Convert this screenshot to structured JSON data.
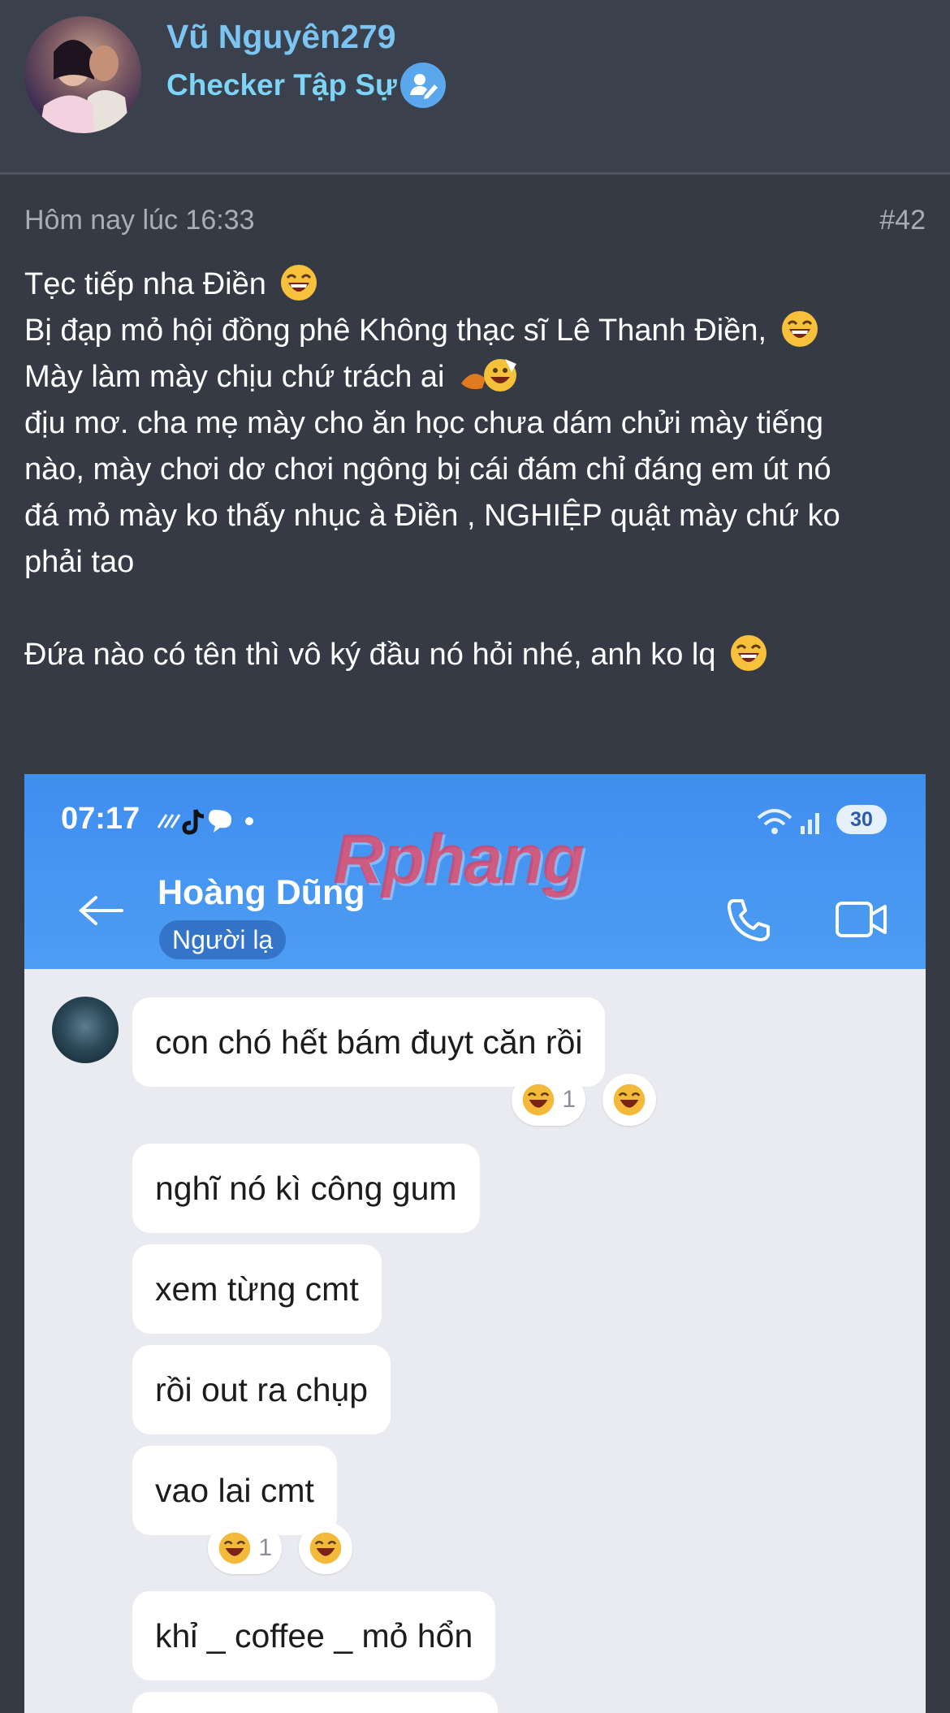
{
  "user": {
    "name": "Vũ Nguyên279",
    "title": "Checker Tập Sự"
  },
  "post": {
    "time": "Hôm nay lúc 16:33",
    "number": "#42",
    "lines": [
      "Tẹc tiếp nha Điền",
      "Bị đạp mỏ hội đồng phê Không thạc sĩ Lê Thanh Điền,",
      "Mày làm mày chịu chứ trách ai",
      "địu mơ. cha mẹ mày cho ăn học chưa dám chửi mày tiếng",
      "nào, mày chơi dơ chơi ngông bị cái đám chỉ đáng em út nó",
      "đá mỏ mày ko thấy nhục à Điền , NGHIỆP quật mày chứ ko",
      "phải tao",
      "Đứa nào có tên thì vô ký đầu nó hỏi nhé, anh ko lq"
    ]
  },
  "embedded": {
    "status_time": "07:17",
    "battery": "30",
    "watermark": "Rphang",
    "contact_name": "Hoàng Dũng",
    "contact_tag": "Người lạ",
    "messages": [
      "con chó hết bám đuyt căn rồi",
      "nghĩ nó kì công gum",
      "xem từng cmt",
      "rồi out ra chụp",
      "vao lai cmt",
      "khỉ _ coffee _ mỏ hổn"
    ],
    "reactions": {
      "msg1_count": "1",
      "msg5_count": "1"
    }
  },
  "colors": {
    "background": "#353a45",
    "username": "#7cc4f2",
    "badge": "#5aa7ee",
    "chat_header": "#4d9df3",
    "chat_bg": "#e9ebf0"
  },
  "icons": [
    "verified-badge-icon",
    "laugh-emoji-icon",
    "fire-laugh-emoji-icon",
    "back-arrow-icon",
    "phone-icon",
    "video-call-icon",
    "wifi-icon",
    "signal-icon",
    "tiktok-icon"
  ]
}
